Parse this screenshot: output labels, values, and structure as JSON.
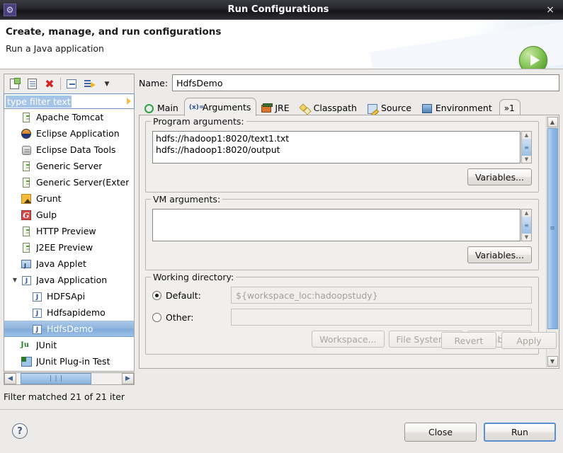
{
  "titlebar": {
    "icon": "gear-icon",
    "title": "Run Configurations",
    "close": "×"
  },
  "header": {
    "title": "Create, manage, and run configurations",
    "subtitle": "Run a Java application",
    "badge_icon": "run-play-icon"
  },
  "left_panel": {
    "toolbar": [
      {
        "name": "new-configuration-icon",
        "label": ""
      },
      {
        "name": "duplicate-configuration-icon",
        "label": ""
      },
      {
        "name": "delete-configuration-icon",
        "label": "✖"
      },
      {
        "name": "collapse-all-icon",
        "label": ""
      },
      {
        "name": "filter-configurations-icon",
        "label": ""
      },
      {
        "name": "view-menu-chevron-icon",
        "label": "▾"
      }
    ],
    "filter": {
      "value": "type filter text",
      "placeholder": "type filter text"
    },
    "tree": [
      {
        "label": "Apache Tomcat",
        "icon": "server-icon",
        "indent": 1,
        "twisty": "",
        "selected": false
      },
      {
        "label": "Eclipse Application",
        "icon": "eclipse-icon",
        "indent": 1,
        "twisty": "",
        "selected": false
      },
      {
        "label": "Eclipse Data Tools",
        "icon": "database-icon",
        "indent": 1,
        "twisty": "",
        "selected": false
      },
      {
        "label": "Generic Server",
        "icon": "server-icon",
        "indent": 1,
        "twisty": "",
        "selected": false
      },
      {
        "label": "Generic Server(Exter",
        "icon": "server-icon",
        "indent": 1,
        "twisty": "",
        "selected": false
      },
      {
        "label": "Grunt",
        "icon": "grunt-icon",
        "indent": 1,
        "twisty": "",
        "selected": false
      },
      {
        "label": "Gulp",
        "icon": "gulp-icon",
        "indent": 1,
        "twisty": "",
        "selected": false
      },
      {
        "label": "HTTP Preview",
        "icon": "server-icon",
        "indent": 1,
        "twisty": "",
        "selected": false
      },
      {
        "label": "J2EE Preview",
        "icon": "server-icon",
        "indent": 1,
        "twisty": "",
        "selected": false
      },
      {
        "label": "Java Applet",
        "icon": "java-applet-icon",
        "indent": 1,
        "twisty": "",
        "selected": false
      },
      {
        "label": "Java Application",
        "icon": "java-app-icon",
        "indent": 0,
        "twisty": "▼",
        "selected": false
      },
      {
        "label": "HDFSApi",
        "icon": "java-launch-icon",
        "indent": 2,
        "twisty": "",
        "selected": false
      },
      {
        "label": "Hdfsapidemo",
        "icon": "java-launch-icon",
        "indent": 2,
        "twisty": "",
        "selected": false
      },
      {
        "label": "HdfsDemo",
        "icon": "java-launch-icon",
        "indent": 2,
        "twisty": "",
        "selected": true
      },
      {
        "label": "JUnit",
        "icon": "junit-icon",
        "indent": 1,
        "twisty": "",
        "selected": false
      },
      {
        "label": "JUnit Plug-in Test",
        "icon": "junit-plugin-icon",
        "indent": 1,
        "twisty": "",
        "selected": false
      }
    ],
    "hscroll": {
      "left_arrow": "◀",
      "right_arrow": "▶",
      "grip": "❘❘❘"
    },
    "status": "Filter matched 21 of 21 iter"
  },
  "right_panel": {
    "name_label": "Name:",
    "name_value": "HdfsDemo",
    "tabs": [
      {
        "label": "Main",
        "icon": "main-icon",
        "active": false
      },
      {
        "label": "Arguments",
        "icon": "arguments-icon",
        "active": true
      },
      {
        "label": "JRE",
        "icon": "jre-icon",
        "active": false
      },
      {
        "label": "Classpath",
        "icon": "classpath-icon",
        "active": false
      },
      {
        "label": "Source",
        "icon": "source-icon",
        "active": false
      },
      {
        "label": "Environment",
        "icon": "environment-icon",
        "active": false
      }
    ],
    "tab_overflow": "»1",
    "program_arguments": {
      "label": "Program arguments:",
      "value": "hdfs://hadoop1:8020/text1.txt\nhdfs://hadoop1:8020/output",
      "variables_button": "Variables..."
    },
    "vm_arguments": {
      "label": "VM arguments:",
      "value": "",
      "variables_button": "Variables..."
    },
    "working_directory": {
      "label": "Working directory:",
      "default_label": "Default:",
      "default_value": "${workspace_loc:hadoopstudy}",
      "default_selected": true,
      "other_label": "Other:",
      "other_value": "",
      "other_selected": false,
      "buttons": [
        "Workspace...",
        "File System...",
        "Variables..."
      ]
    },
    "revert_button": "Revert",
    "apply_button": "Apply"
  },
  "footer": {
    "help_icon": "help-question-icon",
    "close_button": "Close",
    "run_button": "Run"
  },
  "colors": {
    "selection_blue": "#8fb4dd",
    "accent_green": "#5ba22f",
    "titlebar_dark": "#26262c",
    "panel_bg": "#f1efed",
    "disabled_text": "#a9a5a0"
  }
}
